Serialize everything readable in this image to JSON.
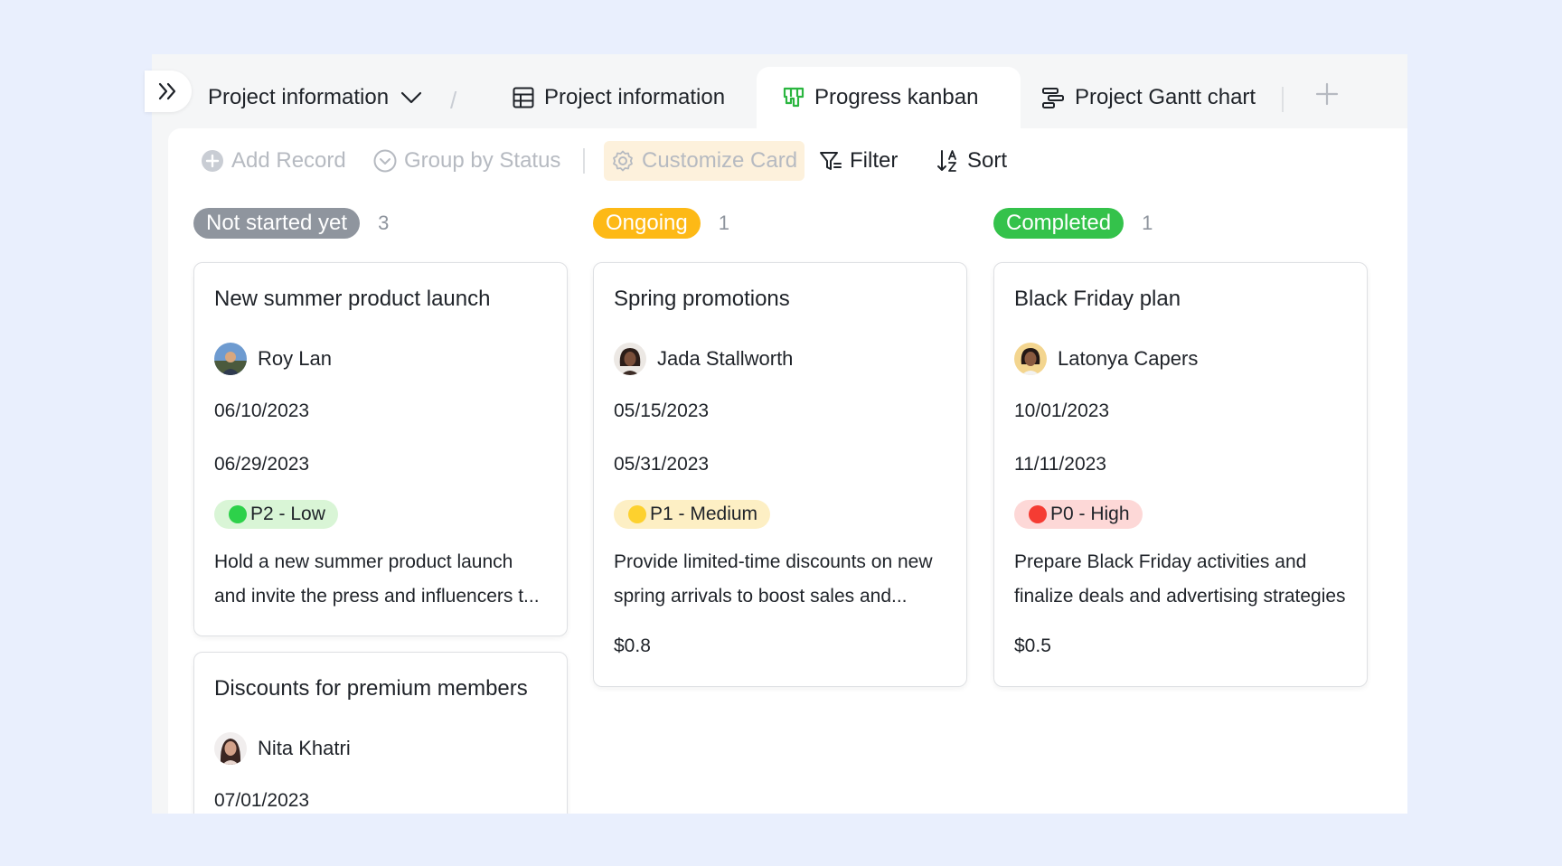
{
  "tabs": {
    "database": "Project information",
    "table_view": "Project information",
    "kanban_view": "Progress kanban",
    "gantt_view": "Project Gantt chart",
    "separator": "/"
  },
  "toolbar": {
    "add_record": "Add Record",
    "group_by": "Group by Status",
    "customize_card": "Customize Card",
    "filter": "Filter",
    "sort": "Sort"
  },
  "colors": {
    "not_started": "#8f959e",
    "ongoing": "#fdb916",
    "completed": "#34c24b",
    "p2_low_bg": "#d9f5d6",
    "p2_low_dot": "#2dd14a",
    "p1_medium_bg": "#fdefc4",
    "p1_medium_dot": "#fdd12e",
    "p0_high_bg": "#fdd8d7",
    "p0_high_dot": "#f53c33"
  },
  "columns": [
    {
      "status": "Not started yet",
      "count": "3",
      "cards": [
        {
          "title": "New summer product launch",
          "owner": "Roy Lan",
          "start": "06/10/2023",
          "end": "06/29/2023",
          "priority": "P2 - Low",
          "description": "Hold a new summer product launch and invite the press and influencers t..."
        },
        {
          "title": "Discounts for premium members",
          "owner": "Nita Khatri",
          "start": "07/01/2023"
        }
      ]
    },
    {
      "status": "Ongoing",
      "count": "1",
      "cards": [
        {
          "title": "Spring promotions",
          "owner": "Jada Stallworth",
          "start": "05/15/2023",
          "end": "05/31/2023",
          "priority": "P1 - Medium",
          "description": "Provide limited-time discounts on new spring arrivals to boost sales and...",
          "amount": "$0.8"
        }
      ]
    },
    {
      "status": "Completed",
      "count": "1",
      "cards": [
        {
          "title": "Black Friday plan",
          "owner": "Latonya Capers",
          "start": "10/01/2023",
          "end": "11/11/2023",
          "priority": "P0 - High",
          "description": "Prepare Black Friday activities and finalize deals and advertising strategies",
          "amount": "$0.5"
        }
      ]
    }
  ]
}
